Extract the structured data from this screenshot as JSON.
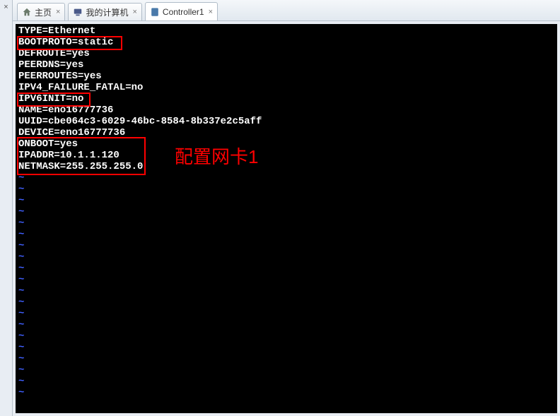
{
  "panel": {
    "close_glyph": "×"
  },
  "tabs": [
    {
      "id": "home",
      "label": "主页",
      "icon": "home-icon"
    },
    {
      "id": "mypc",
      "label": "我的计算机",
      "icon": "computer-icon"
    },
    {
      "id": "controller1",
      "label": "Controller1",
      "icon": "document-icon",
      "active": true
    }
  ],
  "terminal": {
    "lines": [
      "TYPE=Ethernet",
      "BOOTPROTO=static",
      "DEFROUTE=yes",
      "PEERDNS=yes",
      "PEERROUTES=yes",
      "IPV4_FAILURE_FATAL=no",
      "IPV6INIT=no",
      "NAME=eno16777736",
      "UUID=cbe064c3-6029-46bc-8584-8b337e2c5aff",
      "DEVICE=eno16777736",
      "ONBOOT=yes",
      "IPADDR=10.1.1.120",
      "NETMASK=255.255.255.0"
    ],
    "tilde": "~"
  },
  "annotations": {
    "label1": "配置网卡1"
  }
}
